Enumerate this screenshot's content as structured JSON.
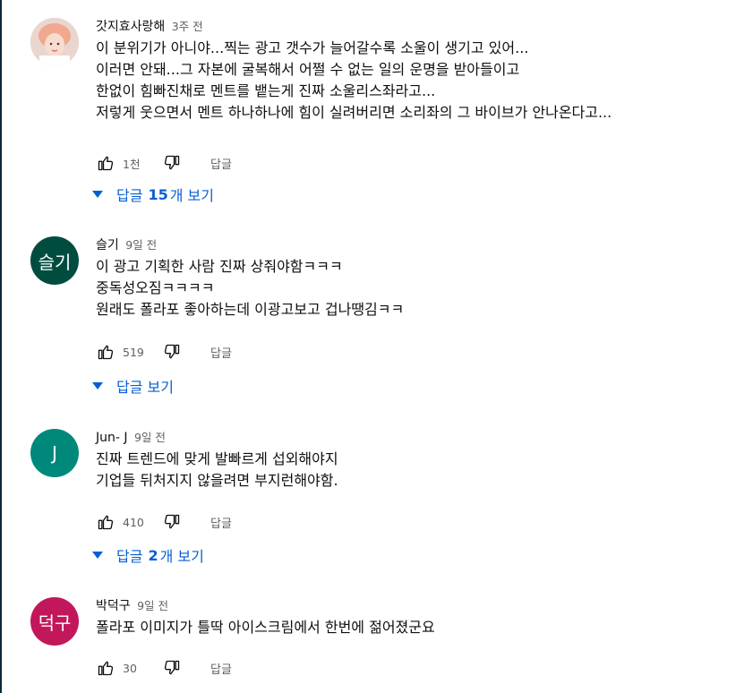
{
  "comments": [
    {
      "author": "갓지효사랑해",
      "time": "3주 전",
      "avatar_text": "",
      "avatar_color": "#f3d4cc",
      "text": "이 분위기가 아니야...찍는 광고 갯수가 늘어갈수록 소울이 생기고 있어...\n이러면 안돼...그 자본에 굴복해서 어쩔 수 없는 일의 운명을 받아들이고\n한없이 힘빠진채로 멘트를 뱉는게 진짜 소울리스좌라고...\n저렇게 웃으면서 멘트 하나하나에 힘이 실려버리면 소리좌의 그 바이브가 안나온다고...",
      "likes": "1천",
      "reply_label": "답글",
      "replies_prefix": "답글",
      "replies_count": "15",
      "replies_suffix": "개 보기"
    },
    {
      "author": "슬기",
      "time": "9일 전",
      "avatar_text": "슬기",
      "avatar_color": "#004d40",
      "text": "이 광고 기획한 사람 진짜 상줘야함ㅋㅋㅋ\n중독성오짐ㅋㅋㅋㅋ\n원래도 폴라포 좋아하는데 이광고보고 겁나땡김ㅋㅋ",
      "likes": "519",
      "reply_label": "답글",
      "replies_prefix": "답글 보기",
      "replies_count": "",
      "replies_suffix": ""
    },
    {
      "author": "Jun- J",
      "time": "9일 전",
      "avatar_text": "J",
      "avatar_color": "#00897b",
      "text": "진짜 트렌드에 맞게 발빠르게 섭외해야지\n기업들 뒤처지지 않을려면 부지런해야함.",
      "likes": "410",
      "reply_label": "답글",
      "replies_prefix": "답글",
      "replies_count": "2",
      "replies_suffix": "개 보기"
    },
    {
      "author": "박덕구",
      "time": "9일 전",
      "avatar_text": "덕구",
      "avatar_color": "#c2185b",
      "text": "폴라포 이미지가 틀딱 아이스크림에서 한번에 젊어졌군요",
      "likes": "30",
      "reply_label": "답글"
    }
  ],
  "icons": {
    "like": "thumb-up-icon",
    "dislike": "thumb-down-icon",
    "expand": "caret-down-icon"
  },
  "colors": {
    "link_blue": "#065fd4",
    "meta_gray": "#606060",
    "text": "#0f0f0f"
  }
}
